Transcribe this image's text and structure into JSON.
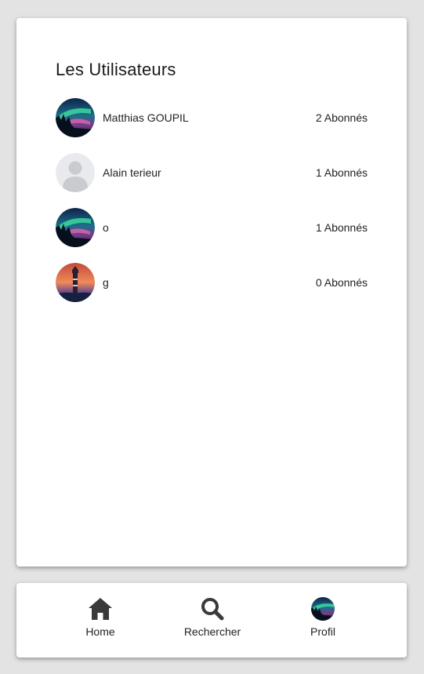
{
  "page": {
    "title": "Les Utilisateurs"
  },
  "users": [
    {
      "name": "Matthias GOUPIL",
      "followers": "2 Abonnés",
      "avatar": "aurora-landscape-avatar"
    },
    {
      "name": "Alain terieur",
      "followers": "1 Abonnés",
      "avatar": "default-user-avatar"
    },
    {
      "name": "o",
      "followers": "1 Abonnés",
      "avatar": "aurora-landscape-avatar"
    },
    {
      "name": "g",
      "followers": "0 Abonnés",
      "avatar": "lighthouse-sunset-avatar"
    }
  ],
  "nav": {
    "home_label": "Home",
    "home_icon": "home-icon",
    "search_label": "Rechercher",
    "search_icon": "search-icon",
    "profile_label": "Profil",
    "profile_icon": "profile-avatar"
  },
  "colors": {
    "background": "#e3e3e3",
    "card": "#ffffff",
    "icon": "#3a3a3a"
  }
}
